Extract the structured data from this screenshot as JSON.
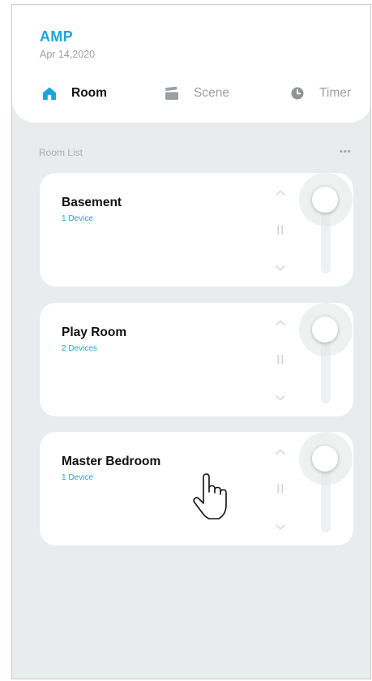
{
  "header": {
    "app_title": "AMP",
    "date": "Apr 14,2020",
    "tabs": [
      {
        "label": "Room",
        "icon": "home-icon",
        "active": true
      },
      {
        "label": "Scene",
        "icon": "clapperboard-icon",
        "active": false
      },
      {
        "label": "Timer",
        "icon": "clock-icon",
        "active": false
      }
    ]
  },
  "room_list": {
    "label": "Room List",
    "more": "•••",
    "rooms": [
      {
        "name": "Basement",
        "devices": "1 Device"
      },
      {
        "name": "Play Room",
        "devices": "2 Devices"
      },
      {
        "name": "Master Bedroom",
        "devices": "1 Device"
      }
    ]
  },
  "colors": {
    "accent": "#1fa3dc",
    "background": "#e8ecec",
    "card": "#ffffff"
  },
  "icons": {
    "up": "chevron-up-icon",
    "pause": "pause-icon",
    "down": "chevron-down-icon",
    "cursor": "hand-pointer-icon"
  }
}
